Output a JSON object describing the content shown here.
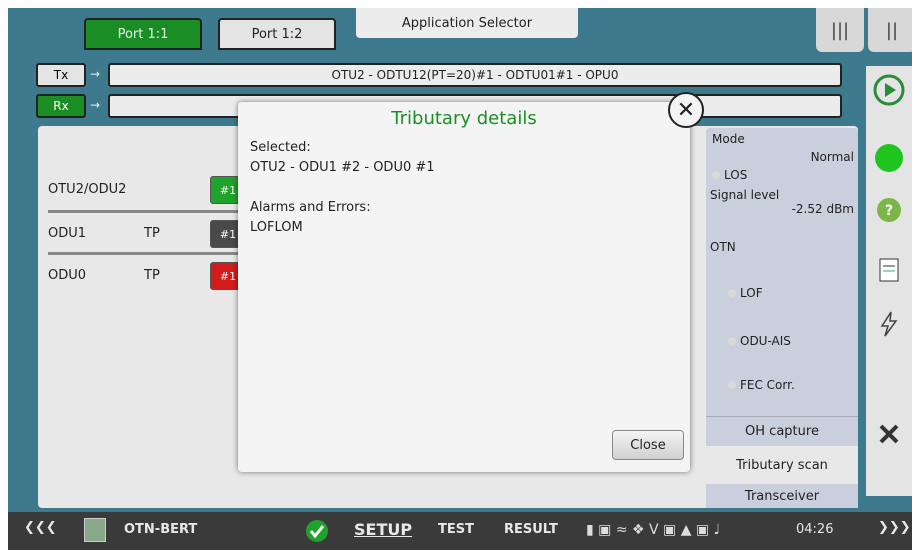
{
  "ports": [
    "Port 1:1",
    "Port 1:2"
  ],
  "app_selector": "Application Selector",
  "tx": {
    "label": "Tx",
    "path": "OTU2 - ODTU12(PT=20)#1 - ODTU01#1 - OPU0"
  },
  "rx": {
    "label": "Rx",
    "path": ""
  },
  "tributaries": [
    {
      "name": "OTU2/ODU2",
      "tp": "",
      "badge": "#1",
      "color": "#1fa32a"
    },
    {
      "name": "ODU1",
      "tp": "TP",
      "badge": "#1",
      "color": "#4a4a4a"
    },
    {
      "name": "ODU0",
      "tp": "TP",
      "badge": "#1",
      "color": "#d21b1b"
    }
  ],
  "status": {
    "mode_label": "Mode",
    "mode_value": "Normal",
    "los": "LOS",
    "signal_label": "Signal level",
    "signal_value": "-2.52 dBm",
    "otn": "OTN",
    "lof": "LOF",
    "odu_ais": "ODU-AIS",
    "fec": "FEC Corr."
  },
  "tabs": [
    "OH capture",
    "Tributary scan",
    "Transceiver"
  ],
  "dialog": {
    "title": "Tributary details",
    "selected_label": "Selected:",
    "selected_value": "OTU2 - ODU1 #2 - ODU0 #1",
    "alarms_label": "Alarms and Errors:",
    "alarms_value": "LOFLOM",
    "close_label": "Close"
  },
  "bottom": {
    "app": "OTN-BERT",
    "setup": "SETUP",
    "test": "TEST",
    "result": "RESULT",
    "time": "04:26"
  },
  "colors": {
    "accent": "#1a8e25",
    "teal": "#3e7a8e"
  }
}
